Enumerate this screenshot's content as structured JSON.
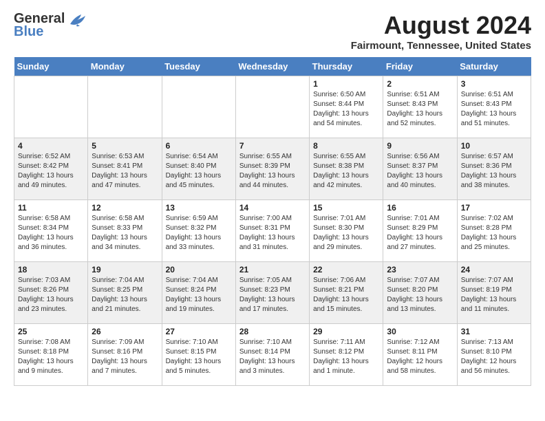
{
  "header": {
    "logo_general": "General",
    "logo_blue": "Blue",
    "month_title": "August 2024",
    "location": "Fairmount, Tennessee, United States"
  },
  "days_of_week": [
    "Sunday",
    "Monday",
    "Tuesday",
    "Wednesday",
    "Thursday",
    "Friday",
    "Saturday"
  ],
  "weeks": [
    [
      {
        "day": "",
        "content": ""
      },
      {
        "day": "",
        "content": ""
      },
      {
        "day": "",
        "content": ""
      },
      {
        "day": "",
        "content": ""
      },
      {
        "day": "1",
        "content": "Sunrise: 6:50 AM\nSunset: 8:44 PM\nDaylight: 13 hours\nand 54 minutes."
      },
      {
        "day": "2",
        "content": "Sunrise: 6:51 AM\nSunset: 8:43 PM\nDaylight: 13 hours\nand 52 minutes."
      },
      {
        "day": "3",
        "content": "Sunrise: 6:51 AM\nSunset: 8:43 PM\nDaylight: 13 hours\nand 51 minutes."
      }
    ],
    [
      {
        "day": "4",
        "content": "Sunrise: 6:52 AM\nSunset: 8:42 PM\nDaylight: 13 hours\nand 49 minutes."
      },
      {
        "day": "5",
        "content": "Sunrise: 6:53 AM\nSunset: 8:41 PM\nDaylight: 13 hours\nand 47 minutes."
      },
      {
        "day": "6",
        "content": "Sunrise: 6:54 AM\nSunset: 8:40 PM\nDaylight: 13 hours\nand 45 minutes."
      },
      {
        "day": "7",
        "content": "Sunrise: 6:55 AM\nSunset: 8:39 PM\nDaylight: 13 hours\nand 44 minutes."
      },
      {
        "day": "8",
        "content": "Sunrise: 6:55 AM\nSunset: 8:38 PM\nDaylight: 13 hours\nand 42 minutes."
      },
      {
        "day": "9",
        "content": "Sunrise: 6:56 AM\nSunset: 8:37 PM\nDaylight: 13 hours\nand 40 minutes."
      },
      {
        "day": "10",
        "content": "Sunrise: 6:57 AM\nSunset: 8:36 PM\nDaylight: 13 hours\nand 38 minutes."
      }
    ],
    [
      {
        "day": "11",
        "content": "Sunrise: 6:58 AM\nSunset: 8:34 PM\nDaylight: 13 hours\nand 36 minutes."
      },
      {
        "day": "12",
        "content": "Sunrise: 6:58 AM\nSunset: 8:33 PM\nDaylight: 13 hours\nand 34 minutes."
      },
      {
        "day": "13",
        "content": "Sunrise: 6:59 AM\nSunset: 8:32 PM\nDaylight: 13 hours\nand 33 minutes."
      },
      {
        "day": "14",
        "content": "Sunrise: 7:00 AM\nSunset: 8:31 PM\nDaylight: 13 hours\nand 31 minutes."
      },
      {
        "day": "15",
        "content": "Sunrise: 7:01 AM\nSunset: 8:30 PM\nDaylight: 13 hours\nand 29 minutes."
      },
      {
        "day": "16",
        "content": "Sunrise: 7:01 AM\nSunset: 8:29 PM\nDaylight: 13 hours\nand 27 minutes."
      },
      {
        "day": "17",
        "content": "Sunrise: 7:02 AM\nSunset: 8:28 PM\nDaylight: 13 hours\nand 25 minutes."
      }
    ],
    [
      {
        "day": "18",
        "content": "Sunrise: 7:03 AM\nSunset: 8:26 PM\nDaylight: 13 hours\nand 23 minutes."
      },
      {
        "day": "19",
        "content": "Sunrise: 7:04 AM\nSunset: 8:25 PM\nDaylight: 13 hours\nand 21 minutes."
      },
      {
        "day": "20",
        "content": "Sunrise: 7:04 AM\nSunset: 8:24 PM\nDaylight: 13 hours\nand 19 minutes."
      },
      {
        "day": "21",
        "content": "Sunrise: 7:05 AM\nSunset: 8:23 PM\nDaylight: 13 hours\nand 17 minutes."
      },
      {
        "day": "22",
        "content": "Sunrise: 7:06 AM\nSunset: 8:21 PM\nDaylight: 13 hours\nand 15 minutes."
      },
      {
        "day": "23",
        "content": "Sunrise: 7:07 AM\nSunset: 8:20 PM\nDaylight: 13 hours\nand 13 minutes."
      },
      {
        "day": "24",
        "content": "Sunrise: 7:07 AM\nSunset: 8:19 PM\nDaylight: 13 hours\nand 11 minutes."
      }
    ],
    [
      {
        "day": "25",
        "content": "Sunrise: 7:08 AM\nSunset: 8:18 PM\nDaylight: 13 hours\nand 9 minutes."
      },
      {
        "day": "26",
        "content": "Sunrise: 7:09 AM\nSunset: 8:16 PM\nDaylight: 13 hours\nand 7 minutes."
      },
      {
        "day": "27",
        "content": "Sunrise: 7:10 AM\nSunset: 8:15 PM\nDaylight: 13 hours\nand 5 minutes."
      },
      {
        "day": "28",
        "content": "Sunrise: 7:10 AM\nSunset: 8:14 PM\nDaylight: 13 hours\nand 3 minutes."
      },
      {
        "day": "29",
        "content": "Sunrise: 7:11 AM\nSunset: 8:12 PM\nDaylight: 13 hours\nand 1 minute."
      },
      {
        "day": "30",
        "content": "Sunrise: 7:12 AM\nSunset: 8:11 PM\nDaylight: 12 hours\nand 58 minutes."
      },
      {
        "day": "31",
        "content": "Sunrise: 7:13 AM\nSunset: 8:10 PM\nDaylight: 12 hours\nand 56 minutes."
      }
    ]
  ]
}
